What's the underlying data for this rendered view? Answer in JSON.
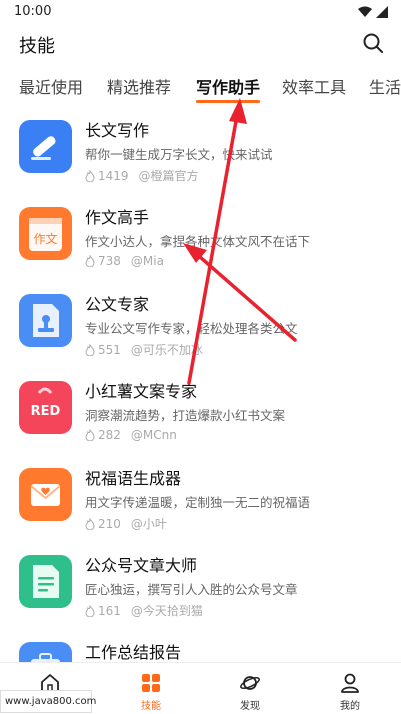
{
  "status_bar": {
    "time": "10:00"
  },
  "header": {
    "title": "技能"
  },
  "tabs": [
    {
      "label": "最近使用"
    },
    {
      "label": "精选推荐"
    },
    {
      "label": "写作助手",
      "active": true
    },
    {
      "label": "效率工具"
    },
    {
      "label": "生活"
    }
  ],
  "skills": [
    {
      "name": "长文写作",
      "desc": "帮你一键生成万字长文，快来试试",
      "uses": "1419",
      "author": "@橙篇官方",
      "icon": "pen-icon",
      "color": "#3b7ff5"
    },
    {
      "name": "作文高手",
      "desc": "作文小达人，拿捏各种文体文风不在话下",
      "uses": "738",
      "author": "@Mia",
      "icon": "essay-icon",
      "color": "#ff7a2e"
    },
    {
      "name": "公文专家",
      "desc": "专业公文写作专家，轻松处理各类公文",
      "uses": "551",
      "author": "@可乐不加冰",
      "icon": "stamp-document-icon",
      "color": "#4a8df5"
    },
    {
      "name": "小红薯文案专家",
      "desc": "洞察潮流趋势，打造爆款小红书文案",
      "uses": "282",
      "author": "@MCnn",
      "icon": "red-bag-icon",
      "color": "#f5455a"
    },
    {
      "name": "祝福语生成器",
      "desc": "用文字传递温暖，定制独一无二的祝福语",
      "uses": "210",
      "author": "@小叶",
      "icon": "heart-envelope-icon",
      "color": "#ff7a2e"
    },
    {
      "name": "公众号文章大师",
      "desc": "匠心独运，撰写引人入胜的公众号文章",
      "uses": "161",
      "author": "@今天拾到猫",
      "icon": "article-icon",
      "color": "#2fbf8a"
    },
    {
      "name": "工作总结报告",
      "desc": "",
      "uses": "",
      "author": "",
      "icon": "briefcase-icon",
      "color": "#4a8df5"
    }
  ],
  "icon_labels": {
    "essay": "作文",
    "red": "RED"
  },
  "bottom_nav": [
    {
      "label": "",
      "icon": "home-icon"
    },
    {
      "label": "技能",
      "icon": "skills-grid-icon",
      "active": true
    },
    {
      "label": "发现",
      "icon": "planet-icon"
    },
    {
      "label": "我的",
      "icon": "user-icon"
    }
  ],
  "watermark": "www.java800.com",
  "colors": {
    "accent": "#ff6a1a",
    "annotation_arrow": "#e8222e"
  }
}
